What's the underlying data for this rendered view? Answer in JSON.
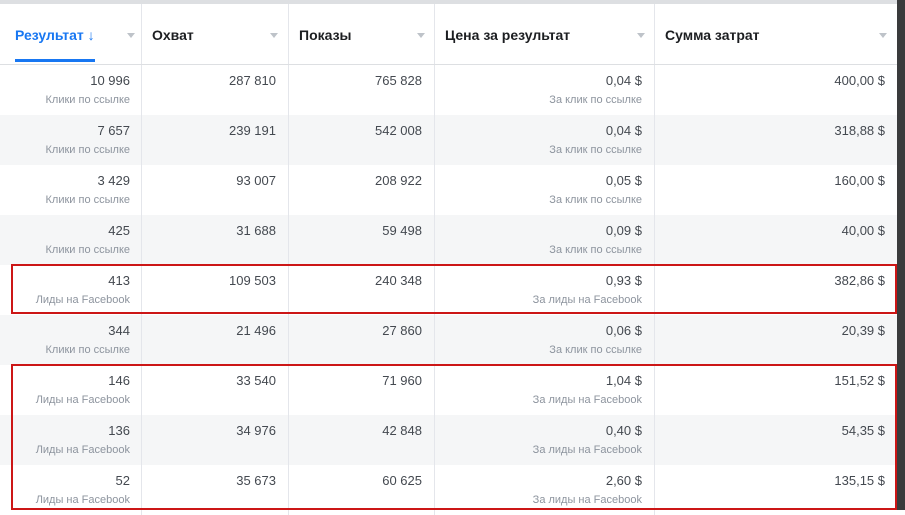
{
  "columns": [
    {
      "label": "Результат",
      "sort_arrow": "↓"
    },
    {
      "label": "Охват"
    },
    {
      "label": "Показы"
    },
    {
      "label": "Цена за результат"
    },
    {
      "label": "Сумма затрат"
    }
  ],
  "rows": [
    {
      "result": "10 996",
      "result_type": "Клики по ссылке",
      "reach": "287 810",
      "impressions": "765 828",
      "cost": "0,04 $",
      "cost_type": "За клик по ссылке",
      "spend": "400,00 $"
    },
    {
      "result": "7 657",
      "result_type": "Клики по ссылке",
      "reach": "239 191",
      "impressions": "542 008",
      "cost": "0,04 $",
      "cost_type": "За клик по ссылке",
      "spend": "318,88 $"
    },
    {
      "result": "3 429",
      "result_type": "Клики по ссылке",
      "reach": "93 007",
      "impressions": "208 922",
      "cost": "0,05 $",
      "cost_type": "За клик по ссылке",
      "spend": "160,00 $"
    },
    {
      "result": "425",
      "result_type": "Клики по ссылке",
      "reach": "31 688",
      "impressions": "59 498",
      "cost": "0,09 $",
      "cost_type": "За клик по ссылке",
      "spend": "40,00 $"
    },
    {
      "result": "413",
      "result_type": "Лиды на Facebook",
      "reach": "109 503",
      "impressions": "240 348",
      "cost": "0,93 $",
      "cost_type": "За лиды на Facebook",
      "spend": "382,86 $"
    },
    {
      "result": "344",
      "result_type": "Клики по ссылке",
      "reach": "21 496",
      "impressions": "27 860",
      "cost": "0,06 $",
      "cost_type": "За клик по ссылке",
      "spend": "20,39 $"
    },
    {
      "result": "146",
      "result_type": "Лиды на Facebook",
      "reach": "33 540",
      "impressions": "71 960",
      "cost": "1,04 $",
      "cost_type": "За лиды на Facebook",
      "spend": "151,52 $"
    },
    {
      "result": "136",
      "result_type": "Лиды на Facebook",
      "reach": "34 976",
      "impressions": "42 848",
      "cost": "0,40 $",
      "cost_type": "За лиды на Facebook",
      "spend": "54,35 $"
    },
    {
      "result": "52",
      "result_type": "Лиды на Facebook",
      "reach": "35 673",
      "impressions": "60 625",
      "cost": "2,60 $",
      "cost_type": "За лиды на Facebook",
      "spend": "135,15 $"
    }
  ],
  "colors": {
    "accent": "#1877f2",
    "highlight_border": "#cc1616",
    "row_alt": "#f5f6f7"
  }
}
